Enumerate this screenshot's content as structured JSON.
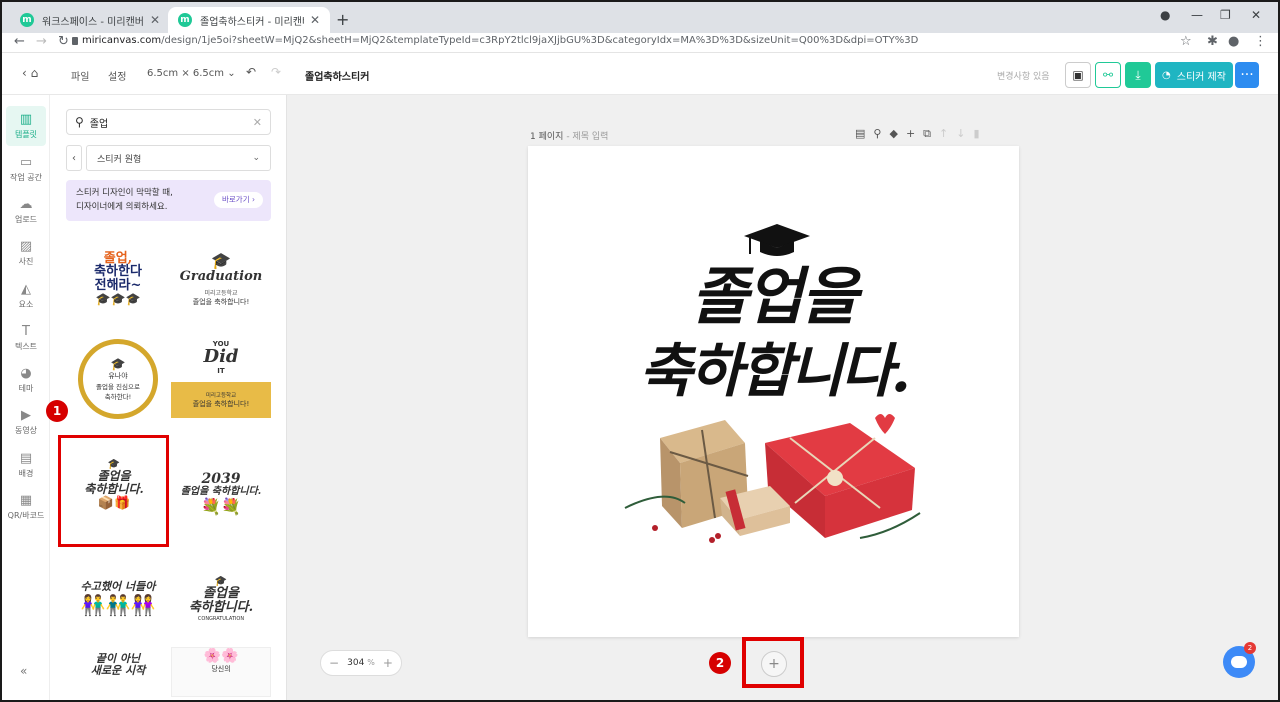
{
  "browser": {
    "tabs": [
      {
        "favicon": "m",
        "title": "워크스페이스 - 미리캔버스"
      },
      {
        "favicon": "m",
        "title": "졸업축하스티커 - 미리캔버스"
      }
    ],
    "url_host": "miricanvas.com",
    "url_path": "/design/1je5oi?sheetW=MjQ2&sheetH=MjQ2&templateTypeId=c3RpY2tlcl9jaXJjbGU%3D&categoryIdx=MA%3D%3D&sizeUnit=Q00%3D&dpi=OTY%3D"
  },
  "header": {
    "file": "파일",
    "settings": "설정",
    "size": "6.5cm × 6.5cm",
    "title": "졸업축하스티커",
    "saved": "변경사항 있음",
    "make_button": "스티커 제작"
  },
  "rail": [
    {
      "icon": "template-icon",
      "label": "템플릿"
    },
    {
      "icon": "workspace-icon",
      "label": "작업 공간"
    },
    {
      "icon": "upload-icon",
      "label": "업로드"
    },
    {
      "icon": "photo-icon",
      "label": "사진"
    },
    {
      "icon": "elements-icon",
      "label": "요소"
    },
    {
      "icon": "text-icon",
      "label": "텍스트"
    },
    {
      "icon": "theme-icon",
      "label": "테마"
    },
    {
      "icon": "video-icon",
      "label": "동영상"
    },
    {
      "icon": "background-icon",
      "label": "배경"
    },
    {
      "icon": "qr-icon",
      "label": "QR/바코드"
    }
  ],
  "panel": {
    "search_value": "졸업",
    "category": "스티커 원형",
    "promo_line1": "스티커 디자인이 막막할 때,",
    "promo_line2": "디자이너에게 의뢰하세요.",
    "promo_button": "바로가기",
    "thumbs": {
      "t1_a": "졸업,",
      "t1_b": "축하한다",
      "t1_c": "전해라~",
      "t2_a": "Graduation",
      "t2_b": "미리고등학교",
      "t2_c": "졸업을 축하합니다!",
      "t3_a": "유나야",
      "t3_b": "졸업을 진심으로",
      "t3_c": "축하한다!",
      "t4_a": "YOU",
      "t4_b": "Did",
      "t4_c": "IT",
      "t4_d": "미리고등학교",
      "t4_e": "졸업을 축하합니다!",
      "t5_a": "졸업을",
      "t5_b": "축하합니다.",
      "t6_a": "2039",
      "t6_b": "졸업을 축하합니다.",
      "t7_a": "수고했어 너들아",
      "t8_a": "졸업을",
      "t8_b": "축하합니다.",
      "t8_c": "CONGRATULATION",
      "t9_a": "끝이 아닌",
      "t9_b": "새로운 시작",
      "t10_a": "당신의"
    }
  },
  "canvas": {
    "page_label": "1 페이지",
    "page_sub": "- 제목 입력",
    "line1": "졸업을",
    "line2": "축하합니다.",
    "zoom": "304",
    "zoom_unit": "%"
  },
  "annotations": {
    "badge1": "1",
    "badge2": "2",
    "chat_count": "2"
  }
}
